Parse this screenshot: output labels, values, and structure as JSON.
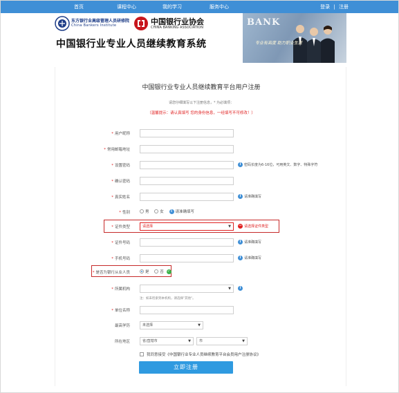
{
  "nav": {
    "items": [
      "首页",
      "课程中心",
      "我的学习",
      "服务中心"
    ],
    "login": "登录",
    "separator": "|",
    "register": "注册"
  },
  "header": {
    "logo1_cn": "东方银行业高级管理人员研修院",
    "logo1_en": "China Bankers Institute",
    "logo2_cn": "中国银行业协会",
    "logo2_en": "CHINA BANKING ASSOCIATION",
    "site_title": "中国银行业专业人员继续教育系统",
    "banner_word": "BANK",
    "banner_slogan": "专业有高度 助力职业生涯"
  },
  "form": {
    "title": "中国银行业专业人员继续教育平台用户注册",
    "instruction": "请您仔细填写以下注册信息，* 为必填项：",
    "warning": "（温馨提示：请认真填写 您的身份信息，一经填写不可修改！）",
    "fields": {
      "username": {
        "label": "用户昵称"
      },
      "email": {
        "label": "常用邮箱地址"
      },
      "password": {
        "label": "设置密码",
        "hint": "密码长度为6-16位，可用英文、数字、特殊字符"
      },
      "confirm": {
        "label": "确认密码"
      },
      "realname": {
        "label": "真实姓名",
        "hint": "请准确填写"
      },
      "gender": {
        "label": "性别",
        "options": [
          "男",
          "女"
        ],
        "hint": "请准确填写"
      },
      "id_type": {
        "label": "证件类型",
        "value": "请选择",
        "error": "请选择证件类型"
      },
      "id_number": {
        "label": "证件号码",
        "hint": "请准确填写"
      },
      "phone": {
        "label": "手机号码",
        "hint": "请准确填写"
      },
      "is_bank_staff": {
        "label": "是否为银行从业人员",
        "options": [
          "是",
          "否"
        ]
      },
      "institution": {
        "label": "所属机构",
        "sub_hint": "注：如未检索到本机构，请选择\"其他\"。"
      },
      "department": {
        "label": "单位名称"
      },
      "education": {
        "label": "最高学历",
        "value": "未选择"
      },
      "region": {
        "label": "所在地区",
        "province": "省/直辖市",
        "city": "市"
      }
    },
    "agreement": {
      "prefix": "我同意接受",
      "link": "《中国银行业专业人员继续教育平台会员用户注册协议》"
    },
    "submit_label": "立即注册"
  }
}
